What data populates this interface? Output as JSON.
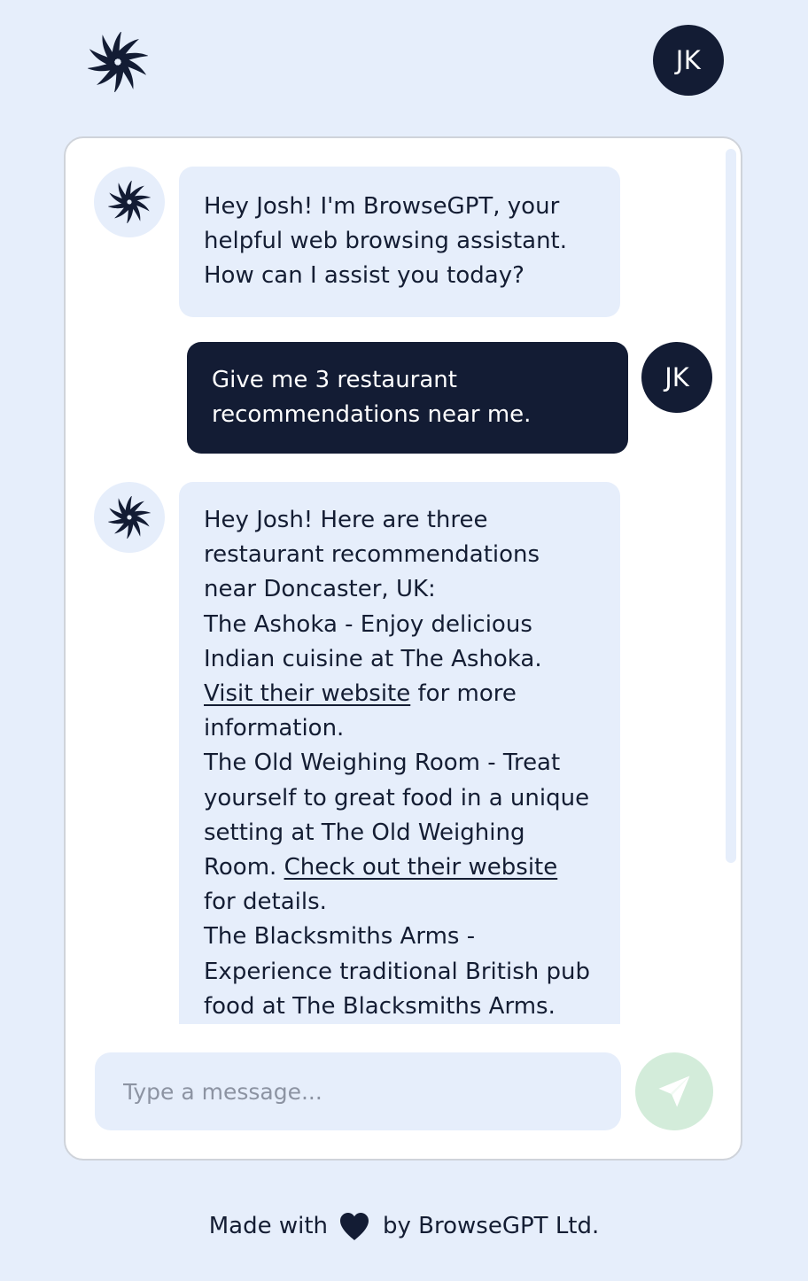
{
  "header": {
    "logo_icon": "spiral-logo-icon",
    "avatar_initials": "JK"
  },
  "chat": {
    "messages": [
      {
        "role": "assistant",
        "icon": "spiral-logo-icon",
        "text": "Hey Josh! I'm BrowseGPT, your helpful web browsing assistant. How can I assist you today?"
      },
      {
        "role": "user",
        "avatar_initials": "JK",
        "text": "Give me 3 restaurant recommendations near me."
      },
      {
        "role": "assistant",
        "icon": "spiral-logo-icon",
        "intro": "Hey Josh! Here are three restaurant recommendations near Doncaster, UK:",
        "recommendations": [
          {
            "text_before": "The Ashoka - Enjoy delicious Indian cuisine at The Ashoka.",
            "link_text": "Visit their website",
            "text_after": "for more information."
          },
          {
            "text_before": "The Old Weighing Room - Treat yourself to great food in a unique setting at The Old Weighing Room.",
            "link_text": "Check out their website",
            "text_after": "for details."
          },
          {
            "text_before": "The Blacksmiths Arms - Experience traditional British pub food at The Blacksmiths Arms."
          }
        ]
      }
    ]
  },
  "composer": {
    "placeholder": "Type a message...",
    "send_icon": "paper-plane-icon"
  },
  "footer": {
    "made_with": "Made with",
    "heart_icon": "heart-icon",
    "by_text": "by BrowseGPT Ltd."
  },
  "colors": {
    "page_background": "#e6eefb",
    "navy": "#131c34",
    "bubble_bot": "#e6eefb",
    "send_button": "#d3ecda",
    "card_border": "#cfd3da"
  }
}
